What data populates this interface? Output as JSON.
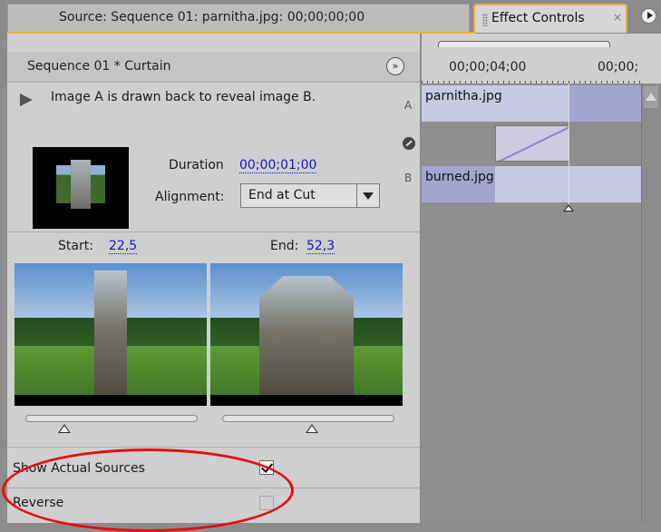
{
  "tabs": {
    "source_label": "Source: Sequence 01: parnitha.jpg: 00;00;00;00",
    "effect_controls_label": "Effect Controls",
    "close_glyph": "×"
  },
  "header": {
    "title": "Sequence 01 * Curtain",
    "run_glyph": "»"
  },
  "transition": {
    "description": "Image A is drawn back to reveal image B.",
    "track_a_label": "A",
    "track_b_label": "B",
    "duration_label": "Duration",
    "duration_value": "00;00;01;00",
    "alignment_label": "Alignment:",
    "alignment_value": "End at Cut",
    "start_label": "Start:",
    "start_value": "22,5",
    "end_label": "End:",
    "end_value": "52,3",
    "start_slider_percent": 22.5,
    "end_slider_percent": 52.3
  },
  "options": {
    "show_actual_sources_label": "Show Actual Sources",
    "show_actual_sources_checked": true,
    "reverse_label": "Reverse",
    "reverse_checked": false
  },
  "timeline": {
    "timecode_1": "00;00;04;00",
    "timecode_2": "00;00;",
    "clip_a": "parnitha.jpg",
    "clip_b": "burned.jpg"
  },
  "colors": {
    "highlight": "#e80d0d",
    "active_tab_border": "#e6b23c",
    "link_value": "#1414c8",
    "clip": "#c8c9e2"
  }
}
